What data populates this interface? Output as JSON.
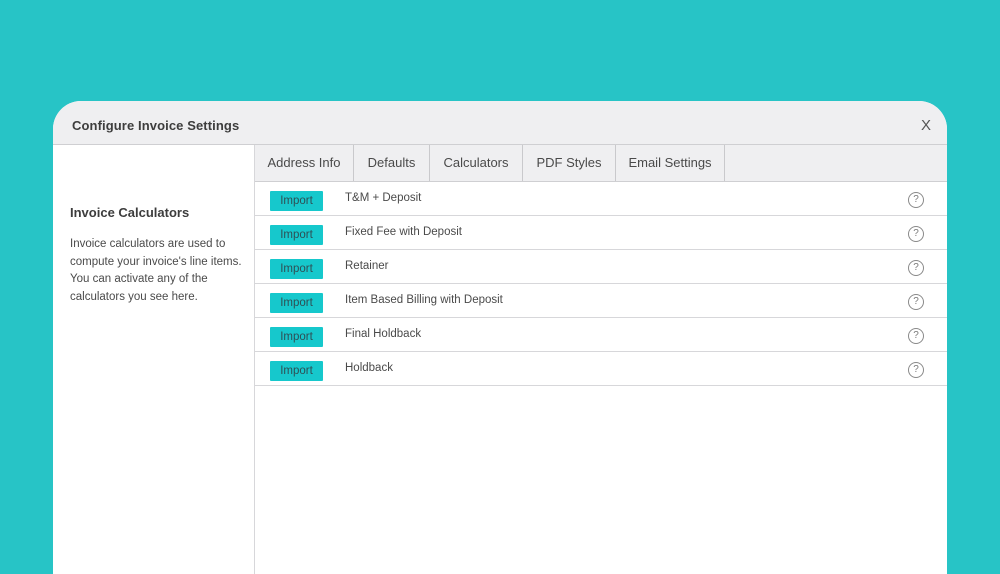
{
  "dialog": {
    "title": "Configure Invoice Settings",
    "close_label": "X"
  },
  "sidebar": {
    "title": "Invoice Calculators",
    "description": "Invoice calculators are used to compute your invoice's line items. You can activate any of the calculators you see here."
  },
  "tabs": [
    {
      "label": "Address Info"
    },
    {
      "label": "Defaults"
    },
    {
      "label": "Calculators"
    },
    {
      "label": "PDF Styles"
    },
    {
      "label": "Email Settings"
    }
  ],
  "calculators": [
    {
      "import_label": "Import",
      "name": "T&M + Deposit",
      "help_icon": "question-circle-icon",
      "help_glyph": "?"
    },
    {
      "import_label": "Import",
      "name": "Fixed Fee with Deposit",
      "help_icon": "question-circle-icon",
      "help_glyph": "?"
    },
    {
      "import_label": "Import",
      "name": "Retainer",
      "help_icon": "question-circle-icon",
      "help_glyph": "?"
    },
    {
      "import_label": "Import",
      "name": "Item Based Billing with Deposit",
      "help_icon": "question-circle-icon",
      "help_glyph": "?"
    },
    {
      "import_label": "Import",
      "name": "Final Holdback",
      "help_icon": "question-circle-icon",
      "help_glyph": "?"
    },
    {
      "import_label": "Import",
      "name": "Holdback",
      "help_icon": "question-circle-icon",
      "help_glyph": "?"
    }
  ],
  "colors": {
    "background": "#27c4c6",
    "import_button": "#16c8cc",
    "header": "#efeff1"
  }
}
